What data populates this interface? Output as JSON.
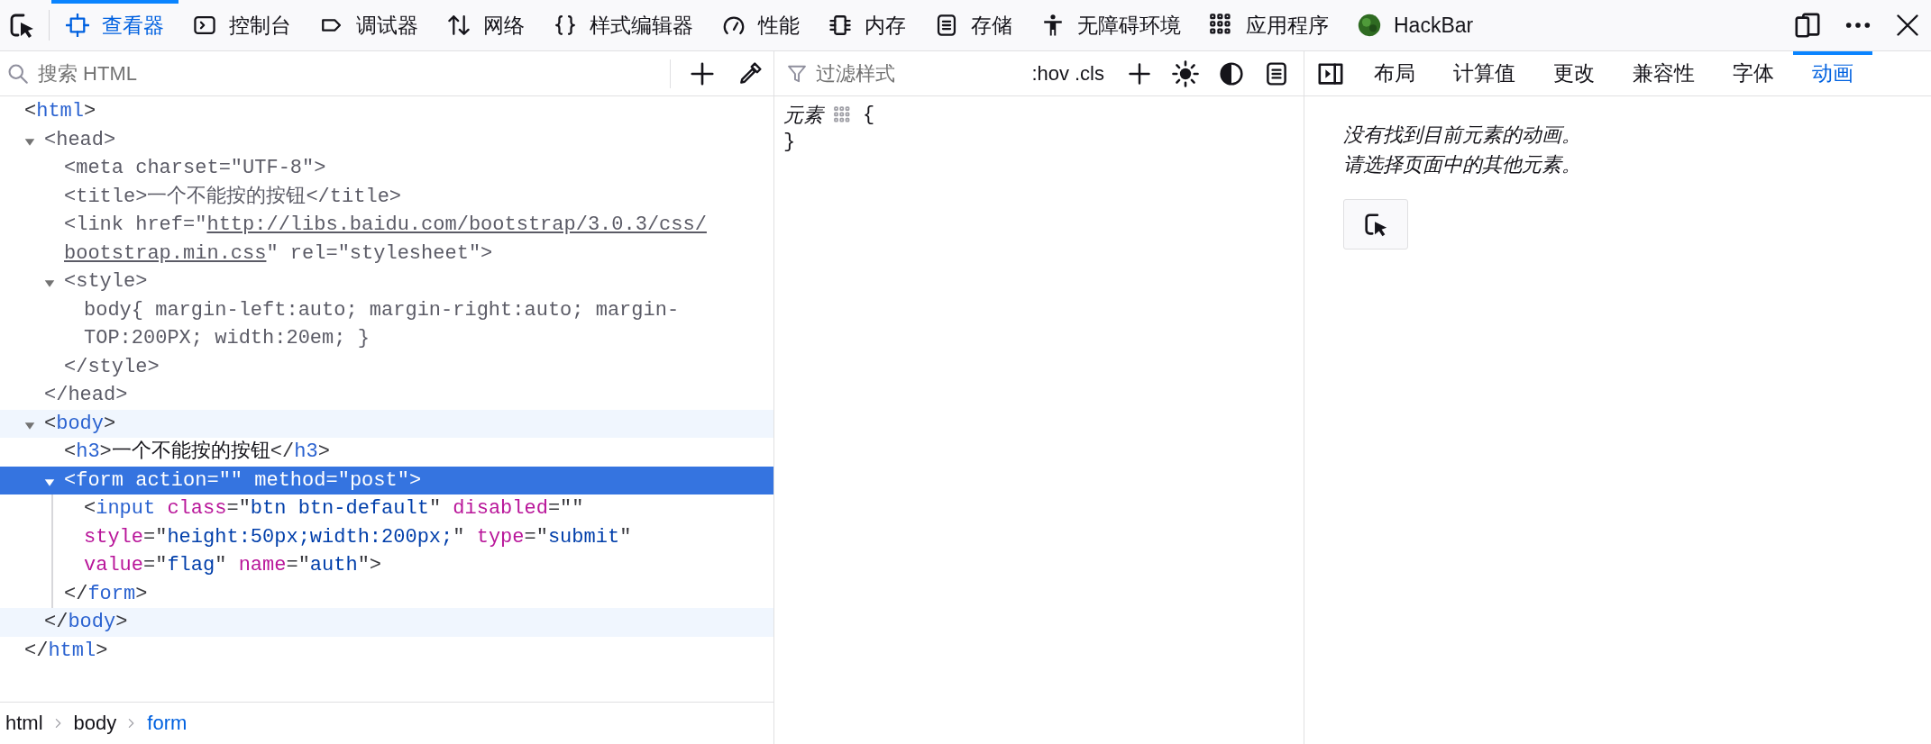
{
  "toolbar": {
    "tabs": [
      {
        "label": "查看器",
        "selected": true
      },
      {
        "label": "控制台",
        "selected": false
      },
      {
        "label": "调试器",
        "selected": false
      },
      {
        "label": "网络",
        "selected": false
      },
      {
        "label": "样式编辑器",
        "selected": false
      },
      {
        "label": "性能",
        "selected": false
      },
      {
        "label": "内存",
        "selected": false
      },
      {
        "label": "存储",
        "selected": false
      },
      {
        "label": "无障碍环境",
        "selected": false
      },
      {
        "label": "应用程序",
        "selected": false
      },
      {
        "label": "HackBar",
        "selected": false
      }
    ]
  },
  "markup": {
    "search": {
      "placeholder": "搜索 HTML"
    },
    "tree": [
      {
        "selected": false,
        "hovered": false,
        "dimmed": false,
        "open": [
          [
            {
              "kind": "p",
              "text": "<"
            },
            {
              "kind": "tag",
              "text": "html"
            },
            {
              "kind": "p",
              "text": ">"
            }
          ]
        ],
        "close": [
          [
            {
              "kind": "p",
              "text": "</"
            },
            {
              "kind": "tag",
              "text": "html"
            },
            {
              "kind": "p",
              "text": ">"
            }
          ]
        ],
        "children": [
          {
            "selected": false,
            "hovered": false,
            "dimmed": true,
            "expanded": true,
            "open": [
              [
                {
                  "kind": "p",
                  "text": "<"
                },
                {
                  "kind": "tag",
                  "text": "head"
                },
                {
                  "kind": "p",
                  "text": ">"
                }
              ]
            ],
            "close": [
              [
                {
                  "kind": "p",
                  "text": "</"
                },
                {
                  "kind": "tag",
                  "text": "head"
                },
                {
                  "kind": "p",
                  "text": ">"
                }
              ]
            ],
            "children": [
              {
                "selected": false,
                "hovered": false,
                "dimmed": true,
                "open": [
                  [
                    {
                      "kind": "p",
                      "text": "<"
                    },
                    {
                      "kind": "tag",
                      "text": "meta"
                    },
                    {
                      "kind": "attr",
                      "text": " charset"
                    },
                    {
                      "kind": "p",
                      "text": "=\""
                    },
                    {
                      "kind": "val",
                      "text": "UTF-8"
                    },
                    {
                      "kind": "p",
                      "text": "\">"
                    }
                  ]
                ]
              },
              {
                "selected": false,
                "hovered": false,
                "dimmed": true,
                "open": [
                  [
                    {
                      "kind": "p",
                      "text": "<"
                    },
                    {
                      "kind": "tag",
                      "text": "title"
                    },
                    {
                      "kind": "p",
                      "text": ">"
                    },
                    {
                      "kind": "text",
                      "text": "一个不能按的按钮"
                    },
                    {
                      "kind": "p",
                      "text": "</"
                    },
                    {
                      "kind": "tag",
                      "text": "title"
                    },
                    {
                      "kind": "p",
                      "text": ">"
                    }
                  ]
                ]
              },
              {
                "selected": false,
                "hovered": false,
                "dimmed": true,
                "open": [
                  [
                    {
                      "kind": "p",
                      "text": "<"
                    },
                    {
                      "kind": "tag",
                      "text": "link"
                    },
                    {
                      "kind": "attr",
                      "text": " href"
                    },
                    {
                      "kind": "p",
                      "text": "=\""
                    },
                    {
                      "kind": "link",
                      "text": "http://libs.baidu.com/bootstrap/3.0.3/css/"
                    }
                  ],
                  [
                    {
                      "kind": "link",
                      "text": "bootstrap.min.css"
                    },
                    {
                      "kind": "p",
                      "text": "\""
                    },
                    {
                      "kind": "attr",
                      "text": " rel"
                    },
                    {
                      "kind": "p",
                      "text": "=\""
                    },
                    {
                      "kind": "val",
                      "text": "stylesheet"
                    },
                    {
                      "kind": "p",
                      "text": "\">"
                    }
                  ]
                ]
              },
              {
                "selected": false,
                "hovered": false,
                "dimmed": true,
                "expanded": true,
                "open": [
                  [
                    {
                      "kind": "p",
                      "text": "<"
                    },
                    {
                      "kind": "tag",
                      "text": "style"
                    },
                    {
                      "kind": "p",
                      "text": ">"
                    }
                  ]
                ],
                "close": [
                  [
                    {
                      "kind": "p",
                      "text": "</"
                    },
                    {
                      "kind": "tag",
                      "text": "style"
                    },
                    {
                      "kind": "p",
                      "text": ">"
                    }
                  ]
                ],
                "children": [
                  {
                    "selected": false,
                    "hovered": false,
                    "dimmed": true,
                    "open": [
                      [
                        {
                          "kind": "text",
                          "text": "body{ margin-left:auto; margin-right:auto; margin-"
                        }
                      ],
                      [
                        {
                          "kind": "text",
                          "text": "TOP:200PX; width:20em; }"
                        }
                      ]
                    ]
                  }
                ]
              }
            ]
          },
          {
            "selected": false,
            "hovered": true,
            "dimmed": false,
            "expanded": true,
            "open": [
              [
                {
                  "kind": "p",
                  "text": "<"
                },
                {
                  "kind": "tag",
                  "text": "body"
                },
                {
                  "kind": "p",
                  "text": ">"
                }
              ]
            ],
            "close": [
              [
                {
                  "kind": "p",
                  "text": "</"
                },
                {
                  "kind": "tag",
                  "text": "body"
                },
                {
                  "kind": "p",
                  "text": ">"
                }
              ]
            ],
            "children": [
              {
                "selected": false,
                "hovered": false,
                "dimmed": false,
                "open": [
                  [
                    {
                      "kind": "p",
                      "text": "<"
                    },
                    {
                      "kind": "tag",
                      "text": "h3"
                    },
                    {
                      "kind": "p",
                      "text": ">"
                    },
                    {
                      "kind": "text",
                      "text": "一个不能按的按钮"
                    },
                    {
                      "kind": "p",
                      "text": "</"
                    },
                    {
                      "kind": "tag",
                      "text": "h3"
                    },
                    {
                      "kind": "p",
                      "text": ">"
                    }
                  ]
                ]
              },
              {
                "selected": true,
                "hovered": false,
                "dimmed": false,
                "expanded": true,
                "open": [
                  [
                    {
                      "kind": "p",
                      "text": "<"
                    },
                    {
                      "kind": "tag",
                      "text": "form"
                    },
                    {
                      "kind": "attr",
                      "text": " action"
                    },
                    {
                      "kind": "p",
                      "text": "=\"\""
                    },
                    {
                      "kind": "attr",
                      "text": " method"
                    },
                    {
                      "kind": "p",
                      "text": "=\""
                    },
                    {
                      "kind": "val",
                      "text": "post"
                    },
                    {
                      "kind": "p",
                      "text": "\">"
                    }
                  ]
                ],
                "close": [
                  [
                    {
                      "kind": "p",
                      "text": "</"
                    },
                    {
                      "kind": "tag",
                      "text": "form"
                    },
                    {
                      "kind": "p",
                      "text": ">"
                    }
                  ]
                ],
                "children": [
                  {
                    "selected": false,
                    "hovered": false,
                    "dimmed": false,
                    "open": [
                      [
                        {
                          "kind": "p",
                          "text": "<"
                        },
                        {
                          "kind": "tag",
                          "text": "input"
                        },
                        {
                          "kind": "attr",
                          "text": " class"
                        },
                        {
                          "kind": "p",
                          "text": "=\""
                        },
                        {
                          "kind": "val",
                          "text": "btn btn-default"
                        },
                        {
                          "kind": "p",
                          "text": "\""
                        },
                        {
                          "kind": "attr",
                          "text": " disabled"
                        },
                        {
                          "kind": "p",
                          "text": "=\"\""
                        }
                      ],
                      [
                        {
                          "kind": "attr",
                          "text": "style"
                        },
                        {
                          "kind": "p",
                          "text": "=\""
                        },
                        {
                          "kind": "val",
                          "text": "height:50px;width:200px;"
                        },
                        {
                          "kind": "p",
                          "text": "\""
                        },
                        {
                          "kind": "attr",
                          "text": " type"
                        },
                        {
                          "kind": "p",
                          "text": "=\""
                        },
                        {
                          "kind": "val",
                          "text": "submit"
                        },
                        {
                          "kind": "p",
                          "text": "\""
                        }
                      ],
                      [
                        {
                          "kind": "attr",
                          "text": "value"
                        },
                        {
                          "kind": "p",
                          "text": "=\""
                        },
                        {
                          "kind": "val",
                          "text": "flag"
                        },
                        {
                          "kind": "p",
                          "text": "\""
                        },
                        {
                          "kind": "attr",
                          "text": " name"
                        },
                        {
                          "kind": "p",
                          "text": "=\""
                        },
                        {
                          "kind": "val",
                          "text": "auth"
                        },
                        {
                          "kind": "p",
                          "text": "\">"
                        }
                      ]
                    ]
                  }
                ]
              }
            ]
          }
        ]
      }
    ],
    "breadcrumbs": [
      {
        "label": "html",
        "selected": false
      },
      {
        "label": "body",
        "selected": false
      },
      {
        "label": "form",
        "selected": true
      }
    ]
  },
  "rules": {
    "filter": {
      "placeholder": "过滤样式"
    },
    "toggles": [
      ":hov",
      ".cls"
    ],
    "rule": {
      "selector": "元素",
      "open": "{",
      "close": "}"
    }
  },
  "sidebar": {
    "tabs": [
      {
        "label": "布局",
        "selected": false
      },
      {
        "label": "计算值",
        "selected": false
      },
      {
        "label": "更改",
        "selected": false
      },
      {
        "label": "兼容性",
        "selected": false
      },
      {
        "label": "字体",
        "selected": false
      },
      {
        "label": "动画",
        "selected": true
      }
    ],
    "messages": [
      "没有找到目前元素的动画。",
      "请选择页面中的其他元素。"
    ]
  }
}
